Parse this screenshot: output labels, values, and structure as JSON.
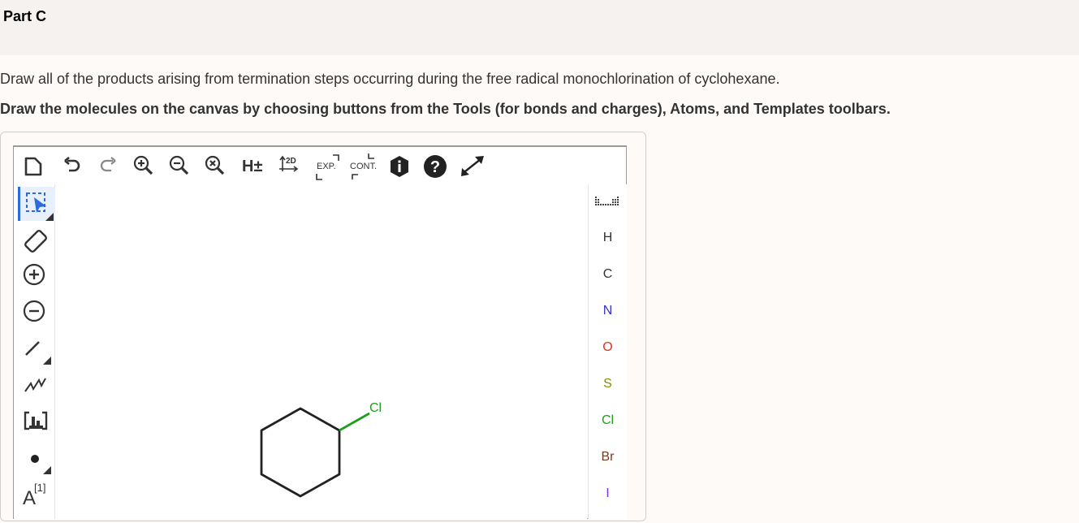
{
  "header": {
    "title": "Part C"
  },
  "instructions": {
    "text": "Draw all of the products arising from termination steps occurring during the free radical monochlorination of cyclohexane.",
    "bold_text": "Draw the molecules on the canvas by choosing buttons from the Tools (for bonds and charges), Atoms, and Templates toolbars."
  },
  "top_toolbar": {
    "h_toggle": "H±",
    "clean_2d": "2D",
    "expand": "EXP.",
    "contract": "CONT."
  },
  "left_toolbar": {
    "atom_map_label": "[1]",
    "atom_map_letter": "A"
  },
  "atoms": [
    {
      "symbol": "H",
      "color": "#333333"
    },
    {
      "symbol": "C",
      "color": "#333333"
    },
    {
      "symbol": "N",
      "color": "#3333cc"
    },
    {
      "symbol": "O",
      "color": "#e0341d"
    },
    {
      "symbol": "S",
      "color": "#8a8a00"
    },
    {
      "symbol": "Cl",
      "color": "#1e9e1e"
    },
    {
      "symbol": "Br",
      "color": "#7a3b1b"
    },
    {
      "symbol": "I",
      "color": "#8a2be2"
    }
  ],
  "molecule": {
    "substituent_label": "Cl",
    "substituent_color": "#1e9e1e",
    "bond_color": "#222222"
  }
}
